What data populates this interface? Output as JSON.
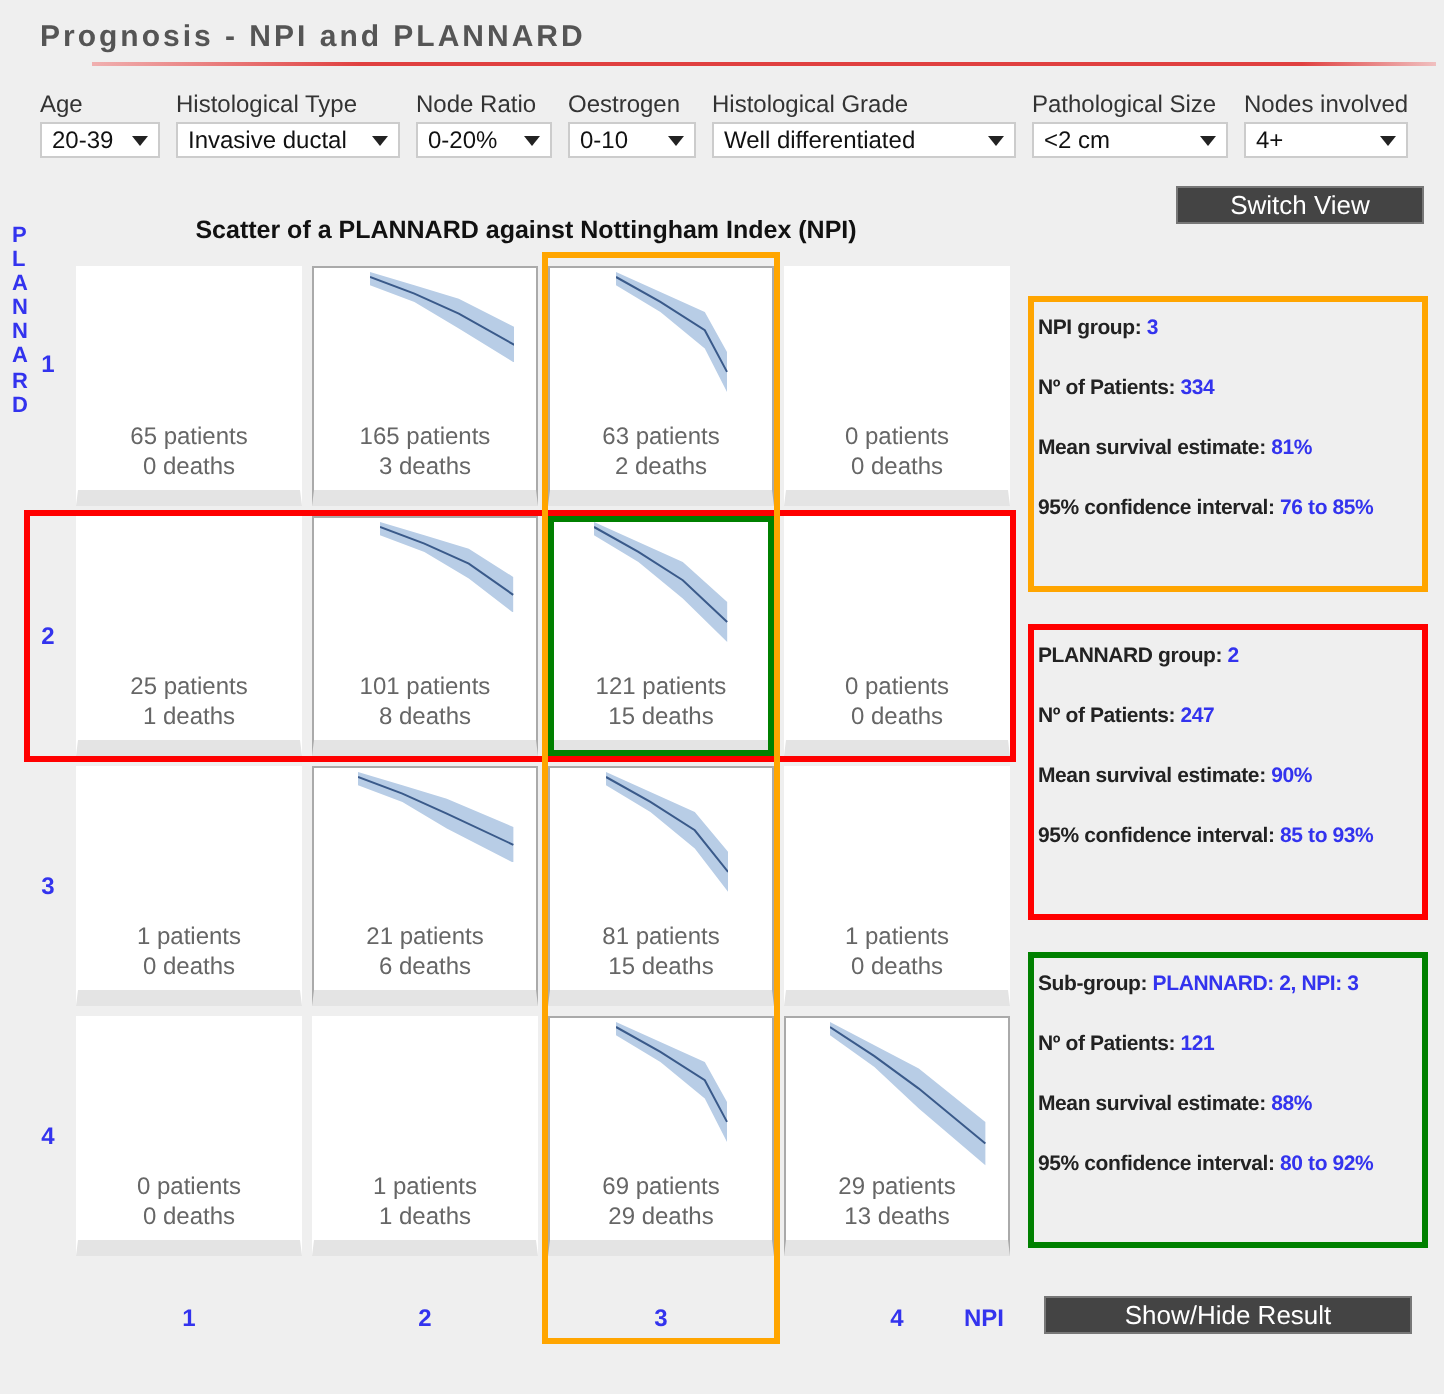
{
  "title": "Prognosis - NPI and PLANNARD",
  "filters": [
    {
      "label": "Age",
      "value": "20-39"
    },
    {
      "label": "Histological Type",
      "value": "Invasive ductal"
    },
    {
      "label": "Node Ratio",
      "value": "0-20%"
    },
    {
      "label": "Oestrogen",
      "value": "0-10"
    },
    {
      "label": "Histological Grade",
      "value": "Well differentiated"
    },
    {
      "label": "Pathological Size",
      "value": "<2 cm"
    },
    {
      "label": "Nodes involved",
      "value": "4+"
    }
  ],
  "switch_button": "Switch View",
  "scatter": {
    "title": "Scatter of a PLANNARD against Nottingham Index (NPI)",
    "ylabel": "PLANNARD",
    "xlabel": "NPI",
    "npi_groups": [
      {
        "label": "1",
        "selected": false
      },
      {
        "label": "2",
        "selected": false
      },
      {
        "label": "3",
        "selected": true
      },
      {
        "label": "4",
        "selected": false
      }
    ],
    "plannard_groups": [
      {
        "label": "1",
        "selected": false,
        "plots": [
          {
            "kind": "empty",
            "patients": "65 patients",
            "deaths": "0 deaths"
          },
          {
            "kind": "curve",
            "patients": "165 patients",
            "deaths": "3 deaths"
          },
          {
            "kind": "curve",
            "patients": "63 patients",
            "deaths": "2 deaths"
          },
          {
            "kind": "empty",
            "patients": "0 patients",
            "deaths": "0 deaths"
          }
        ]
      },
      {
        "label": "2",
        "selected": true,
        "plots": [
          {
            "kind": "empty",
            "patients": "25 patients",
            "deaths": "1 deaths"
          },
          {
            "kind": "curve",
            "patients": "101 patients",
            "deaths": "8 deaths"
          },
          {
            "kind": "curve",
            "patients": "121 patients",
            "deaths": "15 deaths"
          },
          {
            "kind": "empty",
            "patients": "0 patients",
            "deaths": "0 deaths"
          }
        ]
      },
      {
        "label": "3",
        "selected": false,
        "plots": [
          {
            "kind": "empty",
            "patients": "1 patients",
            "deaths": "0 deaths"
          },
          {
            "kind": "curve",
            "patients": "21 patients",
            "deaths": "6 deaths"
          },
          {
            "kind": "curve",
            "patients": "81 patients",
            "deaths": "15 deaths"
          },
          {
            "kind": "empty",
            "patients": "1 patients",
            "deaths": "0 deaths"
          }
        ]
      },
      {
        "label": "4",
        "selected": false,
        "plots": [
          {
            "kind": "empty",
            "patients": "0 patients",
            "deaths": "0 deaths"
          },
          {
            "kind": "empty",
            "patients": "1 patients",
            "deaths": "1 deaths"
          },
          {
            "kind": "curve",
            "patients": "69 patients",
            "deaths": "29 deaths"
          },
          {
            "kind": "curve",
            "patients": "29 patients",
            "deaths": "13 deaths"
          }
        ]
      }
    ]
  },
  "results": [
    {
      "color": "#ffa500",
      "lines": [
        {
          "label": "NPI group:",
          "value": "3"
        },
        {
          "label": "Nº of Patients:",
          "value": "334"
        },
        {
          "label": "Mean survival estimate:",
          "value": "81%"
        },
        {
          "label": "95% confidence interval:",
          "value": "76 to 85%"
        }
      ]
    },
    {
      "color": "#ff0000",
      "lines": [
        {
          "label": "PLANNARD group:",
          "value": "2"
        },
        {
          "label": "Nº of Patients:",
          "value": "247"
        },
        {
          "label": "Mean survival estimate:",
          "value": "90%"
        },
        {
          "label": "95% confidence interval:",
          "value": "85 to 93%"
        }
      ]
    },
    {
      "color": "#008000",
      "lines": [
        {
          "label": "Sub-group:",
          "value": "PLANNARD: 2, NPI: 3"
        },
        {
          "label": "Nº of Patients:",
          "value": "121"
        },
        {
          "label": "Mean survival estimate:",
          "value": "88%"
        },
        {
          "label": "95% confidence interval:",
          "value": "80 to 92%"
        }
      ]
    }
  ],
  "show_hide_button": "Show/Hide Result"
}
